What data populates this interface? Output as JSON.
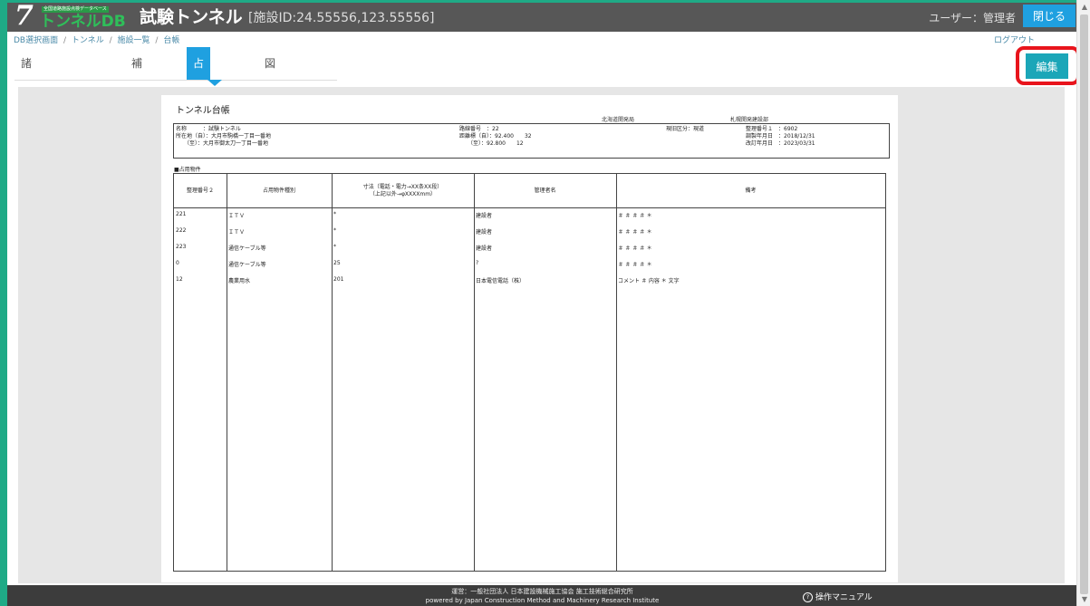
{
  "header": {
    "logo_sub": "全国道路施設点検データベース",
    "logo_text": "トンネルDB",
    "app_title": "試験トンネル",
    "facility_id": "[施設ID:24.55556,123.55556]",
    "user_label": "ユーザー：管理者",
    "close_label": "閉じる"
  },
  "breadcrumb": [
    {
      "label": "DB選択画面"
    },
    {
      "label": "トンネル"
    },
    {
      "label": "施設一覧"
    },
    {
      "label": "台帳"
    }
  ],
  "breadcrumb_sep": "/",
  "logout_label": "ログアウト",
  "tabs": [
    {
      "label": "諸元・基礎情報",
      "active": false
    },
    {
      "label": "補修履歴",
      "active": false
    },
    {
      "label": "占用物件",
      "active": true
    },
    {
      "label": "図面ファイル",
      "active": false
    }
  ],
  "edit_label": "編集",
  "document": {
    "title": "トンネル台帳",
    "org1": "北海道開発局",
    "org2": "札幌開発建設部",
    "info": {
      "name": "名称　　　：試験トンネル",
      "loc_from": "所在地（自）：大月市駒橋一丁目一番地",
      "loc_to": "　　（至）：大月市御太刀一丁目一番地",
      "route": "路線番号　：22",
      "dist_from": "距離標（自）：92.400　　32",
      "dist_to": "　　（至）：92.800　　12",
      "old_class": "現旧区分：現道",
      "ref_no": "整理番号１　：6902",
      "survey_date": "調製年月日　：2018/12/31",
      "revise_date": "改訂年月日　：2023/03/31"
    },
    "section_label": "■占用物件",
    "columns": [
      "整理番号２",
      "占用物件種別",
      "寸法（電話・電力→XX条XX段）\n（上記以外→φXXXXmm）",
      "管理者名",
      "備考"
    ],
    "rows": [
      {
        "no": "221",
        "type": "ＩＴＶ",
        "size": "*",
        "manager": "建設者",
        "note": "＃ ＃ ＃ ＃ ＊"
      },
      {
        "no": "222",
        "type": "ＩＴＶ",
        "size": "*",
        "manager": "建設者",
        "note": "＃ ＃ ＃ ＃ ＊"
      },
      {
        "no": "223",
        "type": "通信ケーブル等",
        "size": "*",
        "manager": "建設者",
        "note": "＃ ＃ ＃ ＃ ＊"
      },
      {
        "no": "0",
        "type": "通信ケーブル等",
        "size": "25",
        "manager": "?",
        "note": "＃ ＃ ＃ ＃ ＊"
      },
      {
        "no": "12",
        "type": "農業用水",
        "size": "201",
        "manager": "日本電信電話（株）",
        "note": "コメント ＃ 内容 ＊ 文字"
      }
    ]
  },
  "footer": {
    "line1": "運営：一般社団法人 日本建設機械施工協会 施工技術総合研究所",
    "line2": "powered by Japan Construction Method and Machinery Research Institute",
    "manual_label": "操作マニュアル"
  },
  "colors": {
    "header_bg": "#575757",
    "active_tab": "#1fa0e0",
    "edit_button": "#1ba6b8",
    "highlight": "#e8141c"
  }
}
